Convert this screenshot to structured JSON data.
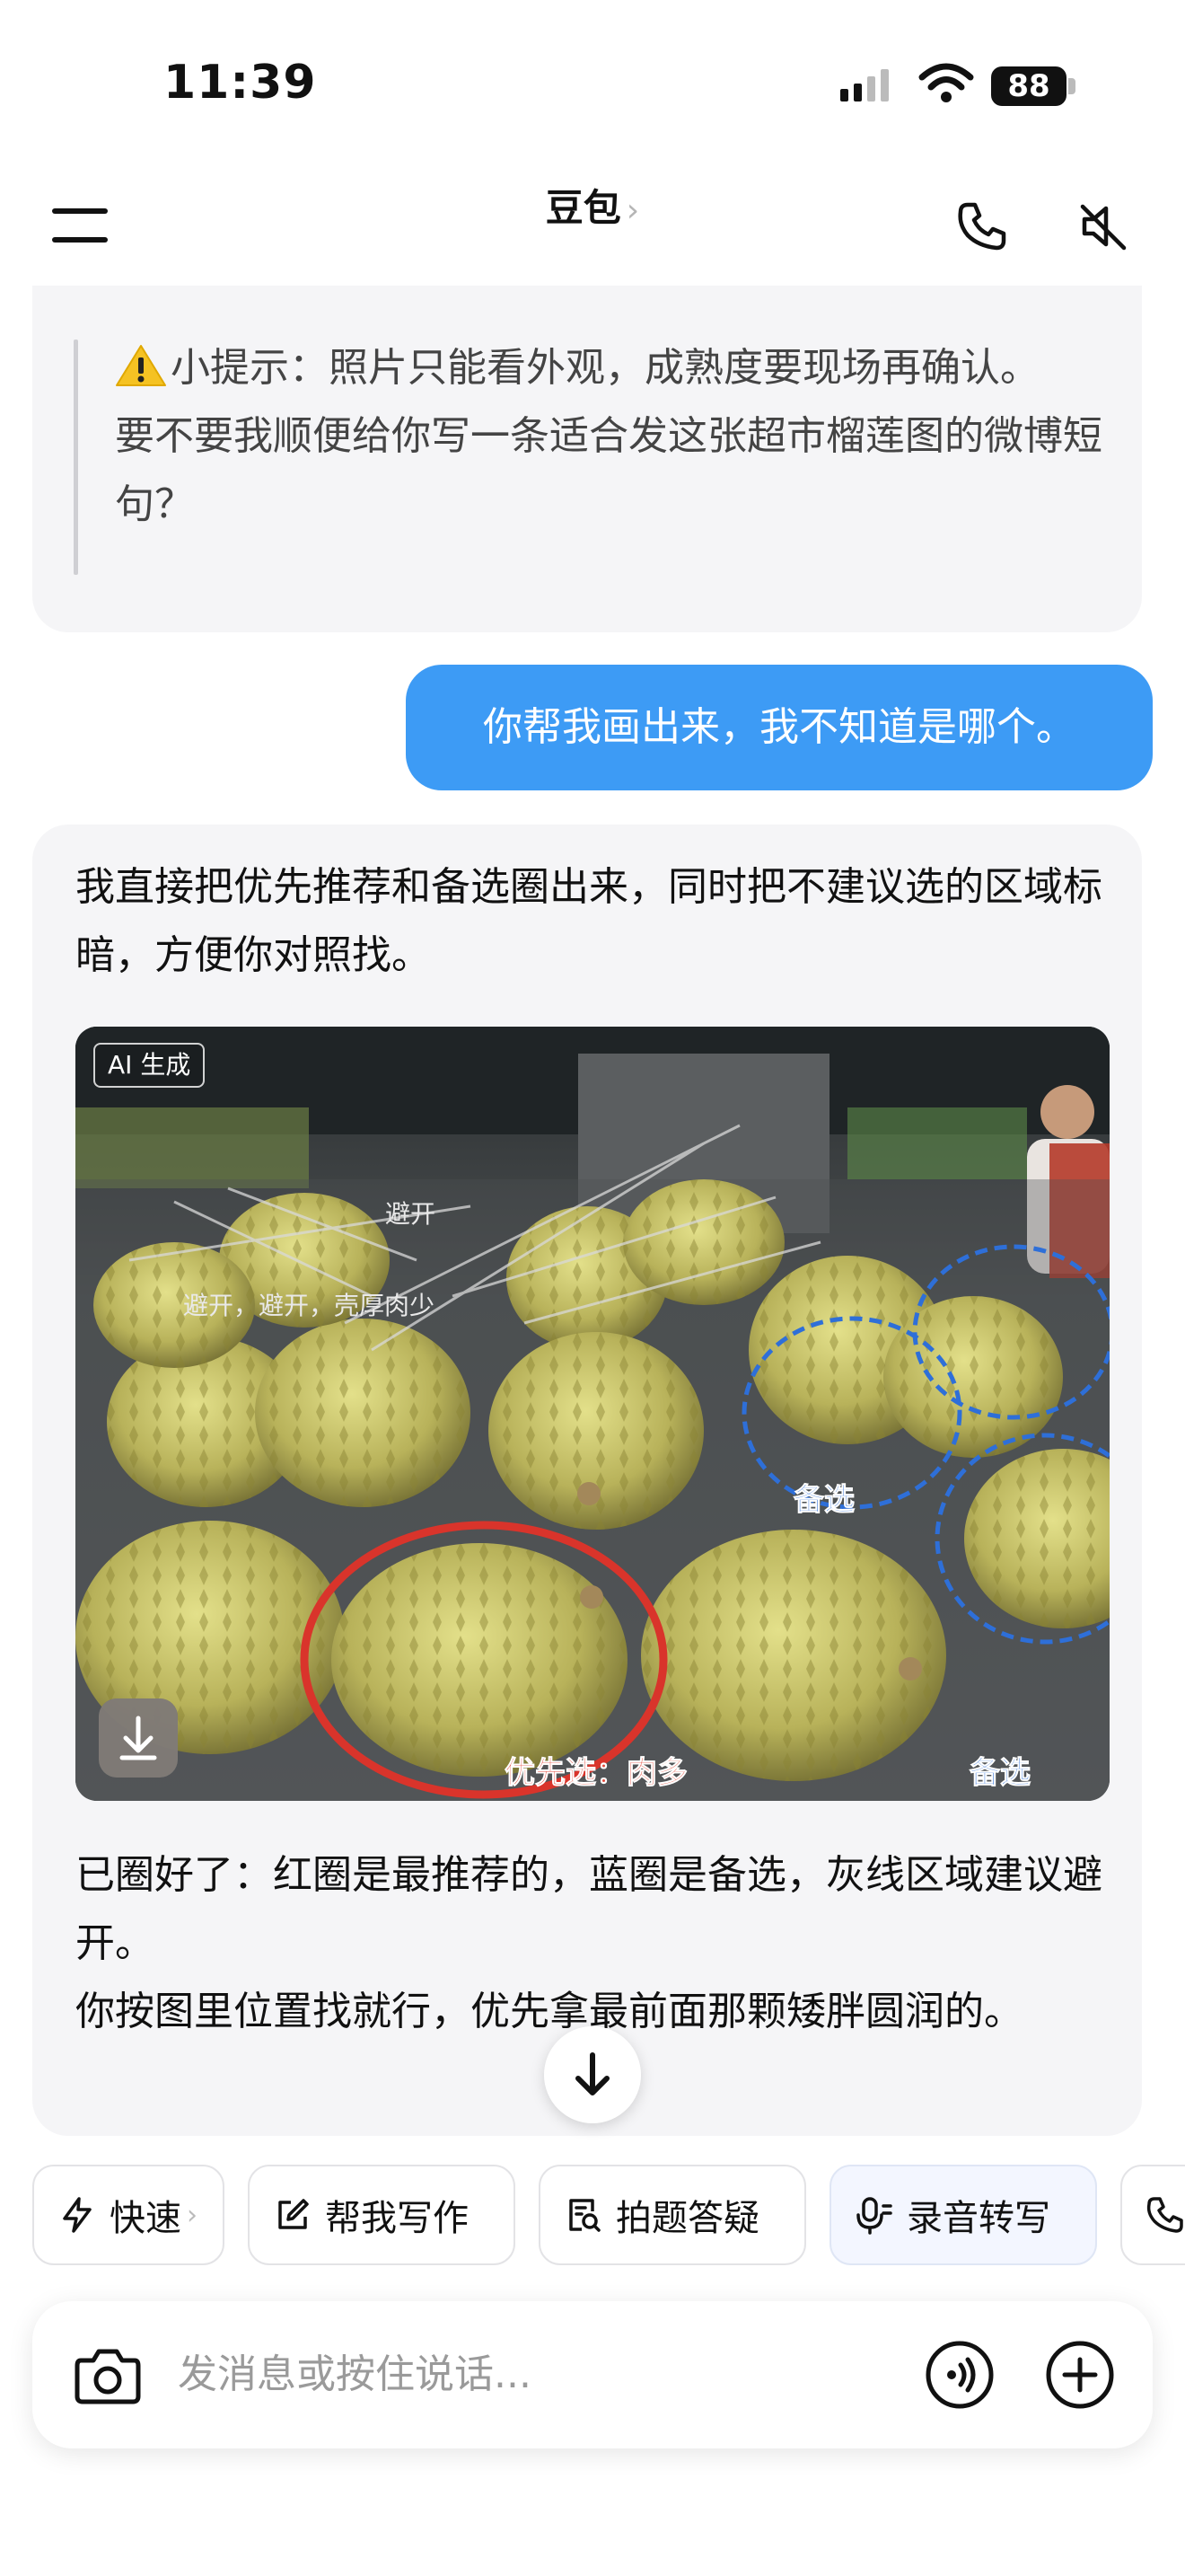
{
  "status": {
    "time": "11:39",
    "battery": "88"
  },
  "header": {
    "title": "豆包",
    "title_chevron": "›"
  },
  "messages": {
    "tip_line1": "小提示：照片只能看外观，成熟度要现场再确认。",
    "tip_line2": "要不要我顺便给你写一条适合发这张超市榴莲图的微博短句？",
    "user": "你帮我画出来，我不知道是哪个。",
    "ai_intro": "我直接把优先推荐和备选圈出来，同时把不建议选的区域标暗，方便你对照找。",
    "ai_outro_1": "已圈好了：红圈是最推荐的，蓝圈是备选，灰线区域建议避开。",
    "ai_outro_2": "你按图里位置找就行，优先拿最前面那颗矮胖圆润的。"
  },
  "image": {
    "ai_tag": "AI 生成",
    "labels": {
      "avoid_top": "避开",
      "avoid_mid": "避开，避开，壳厚肉少",
      "primary": "优先选：肉多",
      "alt_mid": "备选",
      "alt_bottom": "备选"
    }
  },
  "quick_actions": [
    {
      "label": "快速",
      "icon": "lightning-icon"
    },
    {
      "label": "帮我写作",
      "icon": "edit-icon"
    },
    {
      "label": "拍题答疑",
      "icon": "doc-search-icon"
    },
    {
      "label": "录音转写",
      "icon": "mic-icon"
    }
  ],
  "input": {
    "placeholder": "发消息或按住说话..."
  },
  "colors": {
    "user_bubble": "#3d9bf5",
    "ai_bubble": "#f5f5f7",
    "primary_circle": "#d9342b",
    "alt_circle": "#2e6fd8"
  }
}
